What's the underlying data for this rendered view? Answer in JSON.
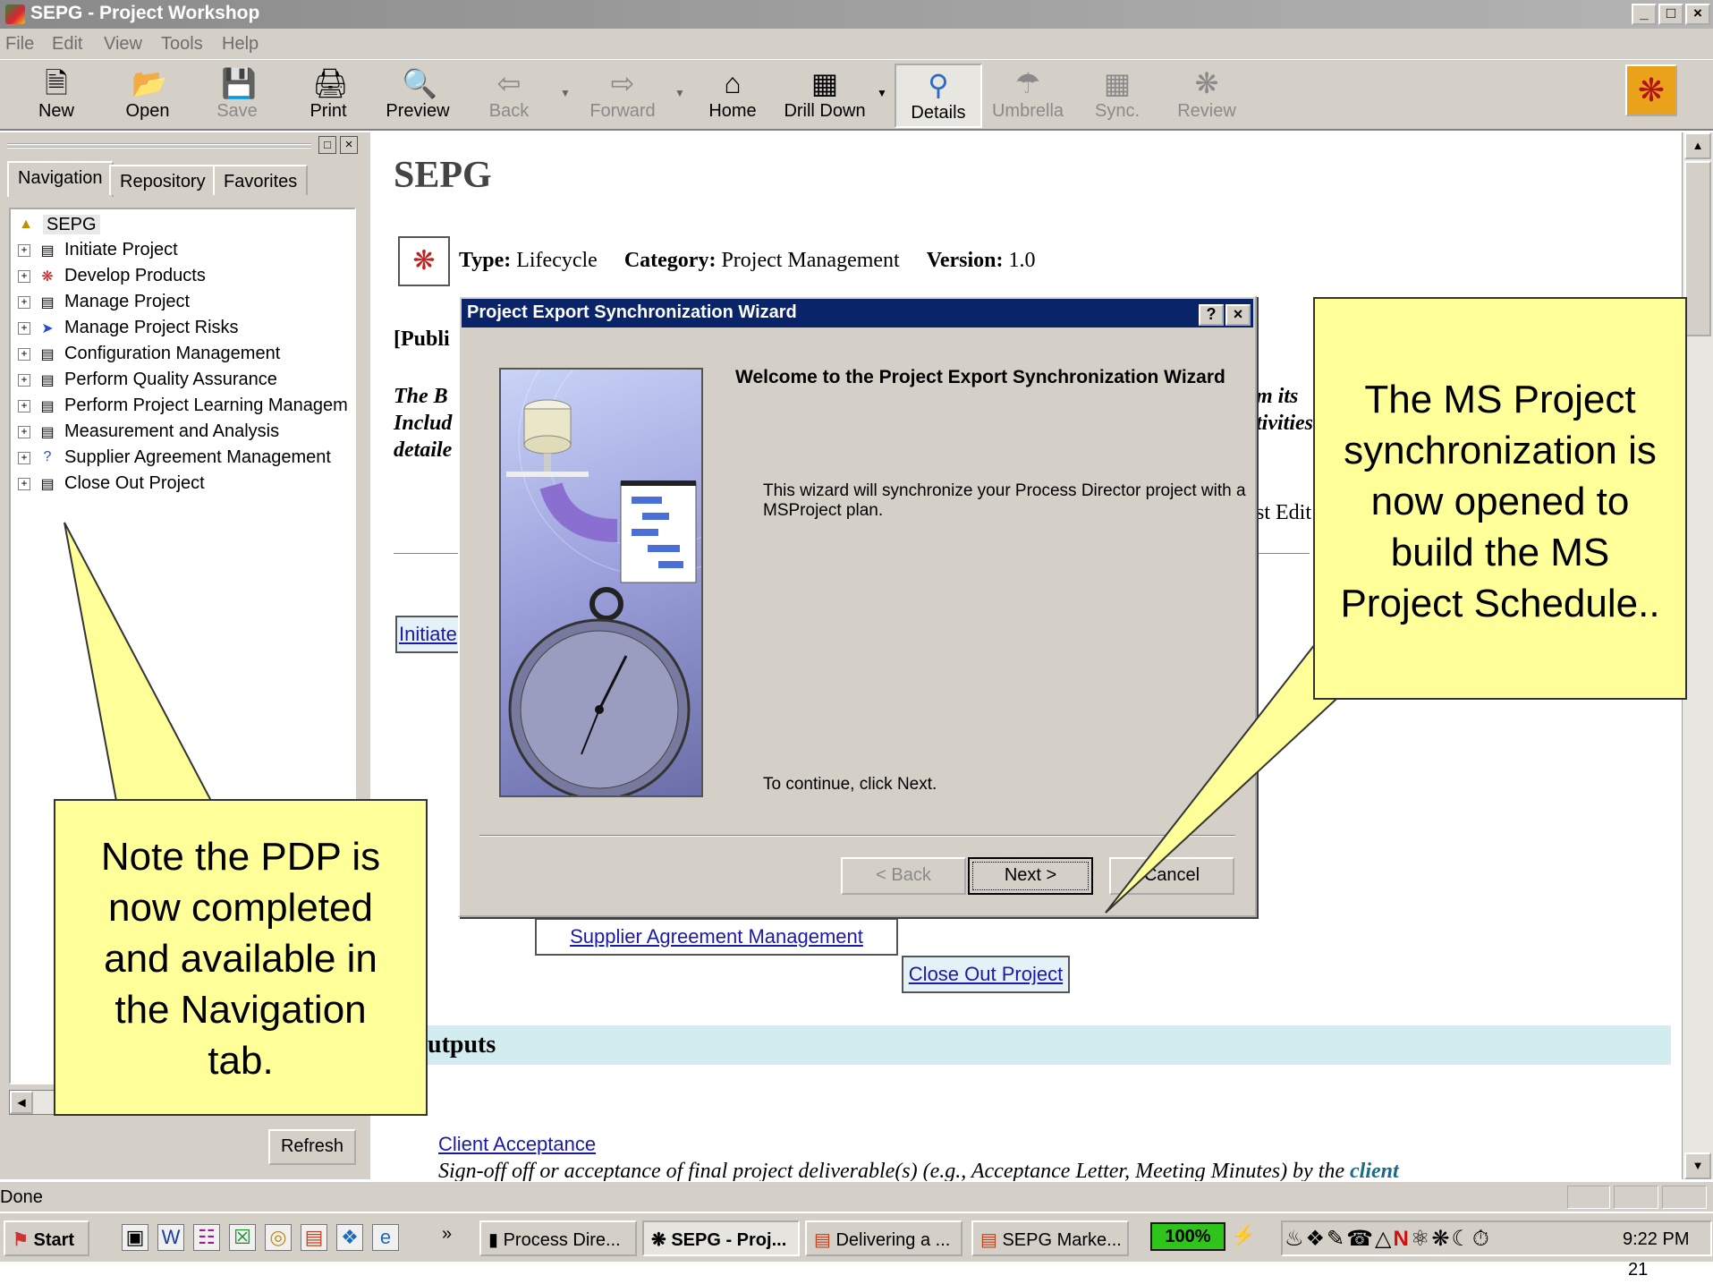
{
  "window": {
    "title": "SEPG - Project Workshop",
    "min_label": "_",
    "max_label": "̸",
    "close_label": "×"
  },
  "menu": [
    "File",
    "Edit",
    "View",
    "Tools",
    "Help"
  ],
  "toolbar": {
    "buttons": [
      {
        "label": "New",
        "icon": "new-document-icon",
        "enabled": true
      },
      {
        "label": "Open",
        "icon": "open-folder-icon",
        "enabled": true
      },
      {
        "label": "Save",
        "icon": "save-disk-icon",
        "enabled": false
      },
      {
        "label": "Print",
        "icon": "printer-icon",
        "enabled": true
      },
      {
        "label": "Preview",
        "icon": "print-preview-icon",
        "enabled": true
      },
      {
        "label": "Back",
        "icon": "back-arrow-icon",
        "enabled": false
      },
      {
        "label": "Forward",
        "icon": "forward-arrow-icon",
        "enabled": false
      },
      {
        "label": "Home",
        "icon": "home-icon",
        "enabled": true
      },
      {
        "label": "Drill Down",
        "icon": "drill-down-icon",
        "enabled": true
      },
      {
        "label": "Details",
        "icon": "magnifier-icon",
        "enabled": true
      },
      {
        "label": "Umbrella",
        "icon": "umbrella-icon",
        "enabled": false
      },
      {
        "label": "Sync.",
        "icon": "sync-icon",
        "enabled": false
      },
      {
        "label": "Review",
        "icon": "review-icon",
        "enabled": false
      }
    ]
  },
  "left_pane": {
    "tabs": [
      "Navigation",
      "Repository",
      "Favorites"
    ],
    "tree_root": "SEPG",
    "tree_items": [
      "Initiate Project",
      "Develop Products",
      "Manage Project",
      "Manage Project Risks",
      "Configuration Management",
      "Perform Quality Assurance",
      "Perform Project Learning Managem",
      "Measurement and Analysis",
      "Supplier Agreement Management",
      "Close Out Project"
    ],
    "refresh_label": "Refresh"
  },
  "content": {
    "title": "SEPG",
    "type_label": "Type:",
    "type_value": "Lifecycle",
    "category_label": "Category:",
    "category_value": "Project Management",
    "version_label": "Version:",
    "version_value": "1.0",
    "published_fragment": "[Publi",
    "desc_line1": "The B",
    "desc_line2": "Includ",
    "desc_line3": "detaile",
    "desc_right1": "m its",
    "desc_right2": "tivities",
    "last_edit_fragment": "st Edit",
    "link_initiate": "Initiate",
    "link_supplier": "Supplier Agreement Management",
    "link_closeout": "Close Out Project",
    "outputs_heading": "utputs",
    "client_acceptance": "Client Acceptance",
    "signoff_prefix": "Sign-off off or acceptance of final project deliverable(s) (e.g., Acceptance Letter, Meeting Minutes) by the",
    "signoff_client": "client"
  },
  "dialog": {
    "title": "Project Export Synchronization Wizard",
    "help_label": "?",
    "close_label": "×",
    "heading": "Welcome to the Project Export Synchronization Wizard",
    "body": "This wizard will synchronize your Process Director project with a MSProject plan.",
    "continue_text": "To continue, click Next.",
    "back_label": "< Back",
    "next_label": "Next >",
    "cancel_label": "Cancel"
  },
  "callouts": {
    "left": "Note the PDP is now completed and available in the Navigation tab.",
    "right": "The MS Project synchronization is now opened to build the MS Project Schedule.."
  },
  "status": {
    "text": "Done"
  },
  "taskbar": {
    "start_label": "Start",
    "quick_launch_more": "»",
    "tasks": [
      "Process Dire...",
      "SEPG - Proj...",
      "Delivering a ...",
      "SEPG Marke..."
    ],
    "zoom": "100%",
    "clock": "9:22 PM"
  },
  "page_number": "21",
  "colors": {
    "title_active": "#0a246a",
    "callout_fill": "#ffff99",
    "outputs_band": "#d3ecf0"
  }
}
